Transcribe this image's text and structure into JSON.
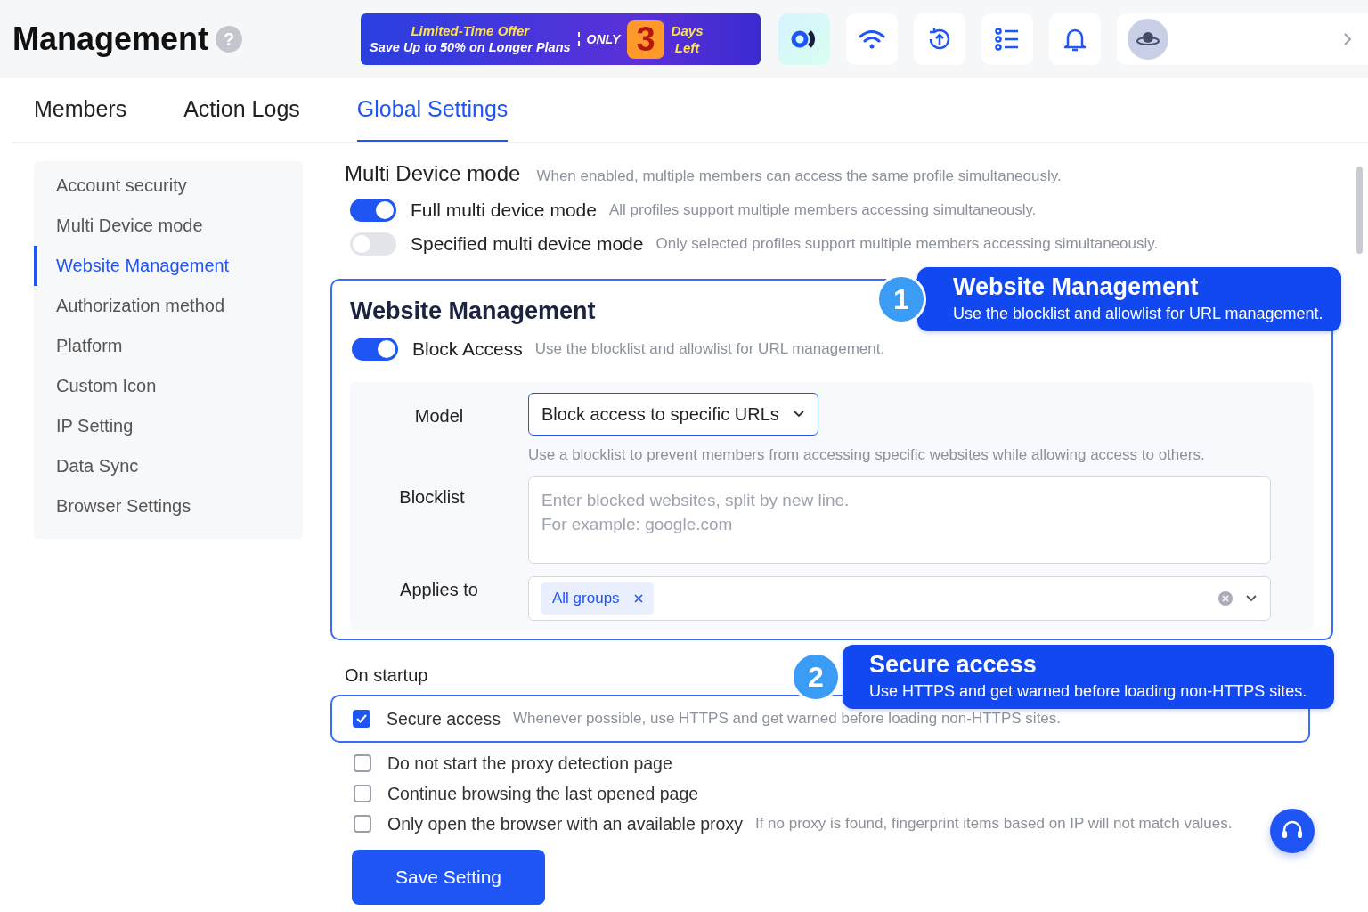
{
  "header": {
    "title": "Management",
    "help": "?",
    "banner": {
      "line_1": "Limited-Time Offer",
      "line_2": "Save Up to 50% on Longer Plans",
      "only": "ONLY",
      "number": "3",
      "days": "Days",
      "left": "Left"
    }
  },
  "tabs": [
    {
      "label": "Members",
      "selected": false
    },
    {
      "label": "Action Logs",
      "selected": false
    },
    {
      "label": "Global Settings",
      "selected": true
    }
  ],
  "sidebar": {
    "items": [
      {
        "label": "Account security",
        "selected": false
      },
      {
        "label": "Multi Device mode",
        "selected": false
      },
      {
        "label": "Website Management",
        "selected": true
      },
      {
        "label": "Authorization method",
        "selected": false
      },
      {
        "label": "Platform",
        "selected": false
      },
      {
        "label": "Custom Icon",
        "selected": false
      },
      {
        "label": "IP Setting",
        "selected": false
      },
      {
        "label": "Data Sync",
        "selected": false
      },
      {
        "label": "Browser Settings",
        "selected": false
      }
    ]
  },
  "multi_device": {
    "title": "Multi Device mode",
    "description": "When enabled, multiple members can access the same profile simultaneously.",
    "options": [
      {
        "label": "Full multi device mode",
        "description": "All profiles support multiple members accessing simultaneously.",
        "on": true
      },
      {
        "label": "Specified multi device mode",
        "description": "Only selected profiles support multiple members accessing simultaneously.",
        "on": false
      }
    ]
  },
  "website_management": {
    "title": "Website Management",
    "block_access": {
      "label": "Block Access",
      "description": "Use the blocklist and allowlist for URL management.",
      "on": true
    },
    "model": {
      "label": "Model",
      "value": "Block access to specific URLs",
      "hint": "Use a blocklist to prevent members from accessing specific websites while allowing access to others."
    },
    "blocklist": {
      "label": "Blocklist",
      "placeholder": "Enter blocked websites, split by new line.\nFor example: google.com"
    },
    "applies_to": {
      "label": "Applies to",
      "tags": [
        {
          "label": "All groups"
        }
      ]
    }
  },
  "startup": {
    "title": "On startup",
    "options": [
      {
        "label": "Secure access",
        "description": "Whenever possible, use HTTPS and get warned before loading non-HTTPS sites.",
        "checked": true,
        "highlighted": true
      },
      {
        "label": "Do not start the proxy detection page",
        "checked": false,
        "highlighted": false
      },
      {
        "label": "Continue browsing the last opened page",
        "checked": false,
        "highlighted": false
      },
      {
        "label": "Only open the browser with an available proxy",
        "description": "If no proxy is found, fingerprint items based on IP will not match values.",
        "checked": false,
        "highlighted": false
      }
    ]
  },
  "save_button": "Save Setting",
  "callouts": [
    {
      "number": "1",
      "title": "Website Management",
      "description": "Use the blocklist and allowlist for URL management."
    },
    {
      "number": "2",
      "title": "Secure access",
      "description": "Use HTTPS and get warned before loading non-HTTPS sites."
    }
  ]
}
